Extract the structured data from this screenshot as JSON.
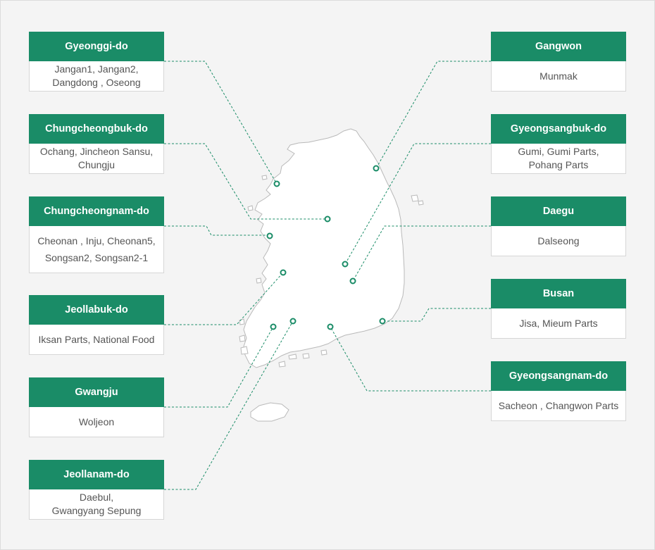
{
  "regions": [
    {
      "id": "gyeonggi",
      "name": "Gyeonggi-do",
      "sites": "Jangan1, Jangan2,\nDangdong , Oseong"
    },
    {
      "id": "chungbuk",
      "name": "Chungcheongbuk-do",
      "sites": "Ochang, Jincheon Sansu,\nChungju"
    },
    {
      "id": "chungnam",
      "name": "Chungcheongnam-do",
      "sites": "Cheonan , Inju, Cheonan5,\nSongsan2, Songsan2-1"
    },
    {
      "id": "jeonbuk",
      "name": "Jeollabuk-do",
      "sites": "Iksan Parts, National Food"
    },
    {
      "id": "gwangju",
      "name": "Gwangju",
      "sites": "Woljeon"
    },
    {
      "id": "jeonnam",
      "name": "Jeollanam-do",
      "sites": "Daebul,\nGwangyang Sepung"
    },
    {
      "id": "gangwon",
      "name": "Gangwon",
      "sites": "Munmak"
    },
    {
      "id": "gyeongbuk",
      "name": "Gyeongsangbuk-do",
      "sites": "Gumi, Gumi Parts,\nPohang Parts"
    },
    {
      "id": "daegu",
      "name": "Daegu",
      "sites": "Dalseong"
    },
    {
      "id": "busan",
      "name": "Busan",
      "sites": "Jisa, Mieum Parts"
    },
    {
      "id": "gyeongnam",
      "name": "Gyeongsangnam-do",
      "sites": "Sacheon , Changwon  Parts"
    }
  ],
  "colors": {
    "accent": "#1a8c67",
    "land": "#ffffff",
    "background": "#f4f4f4"
  }
}
